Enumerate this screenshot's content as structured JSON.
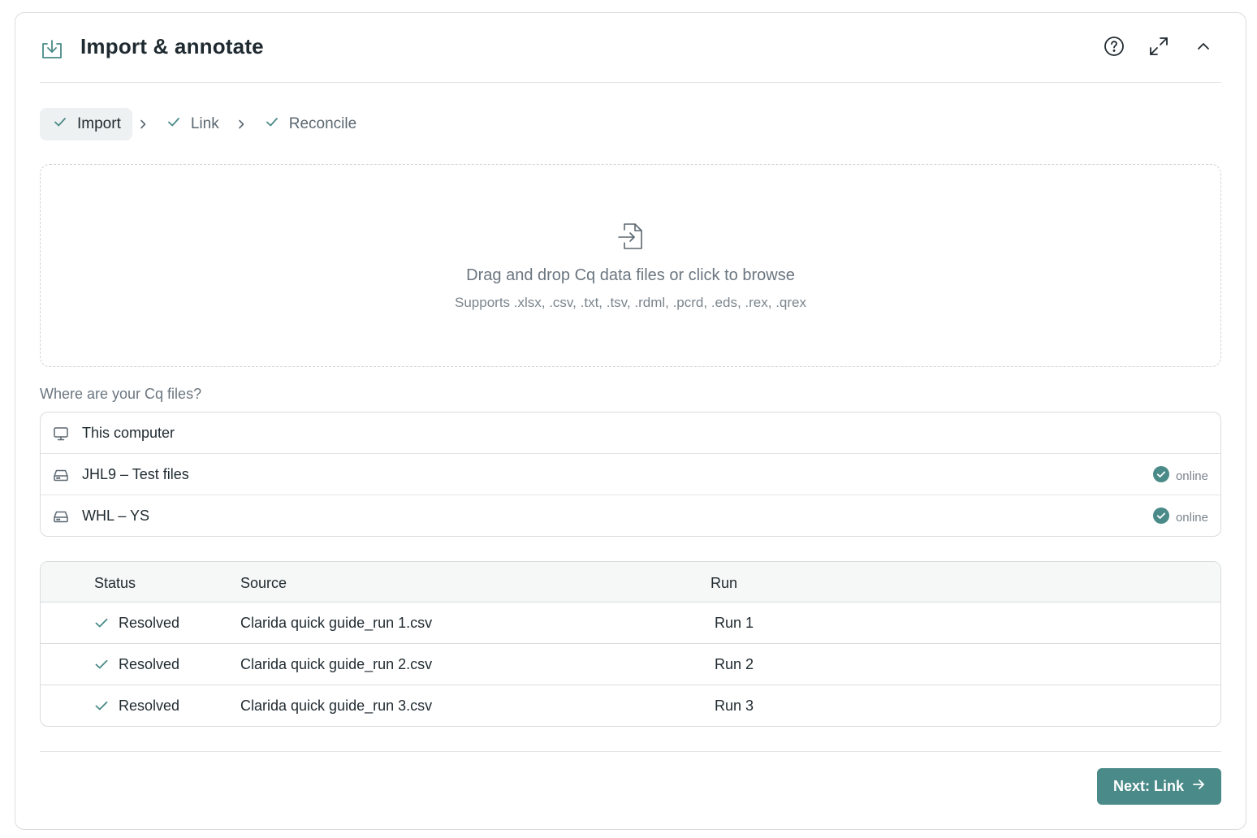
{
  "header": {
    "title": "Import & annotate",
    "icons": [
      "import-tray-icon",
      "help-circle-icon",
      "expand-icon",
      "chevron-up-icon"
    ]
  },
  "steps": [
    {
      "label": "Import",
      "active": true,
      "done": true
    },
    {
      "label": "Link",
      "active": false,
      "done": true
    },
    {
      "label": "Reconcile",
      "active": false,
      "done": true
    }
  ],
  "dropzone": {
    "main_text": "Drag and drop Cq data files or click to browse",
    "sub_text": "Supports .xlsx, .csv, .txt, .tsv, .rdml, .pcrd, .eds, .rex, .qrex"
  },
  "locations": {
    "label": "Where are your Cq files?",
    "items": [
      {
        "name": "This computer",
        "icon": "monitor-icon",
        "status": ""
      },
      {
        "name": "JHL9 – Test files",
        "icon": "drive-icon",
        "status": "online"
      },
      {
        "name": "WHL – YS",
        "icon": "drive-icon",
        "status": "online"
      }
    ]
  },
  "table": {
    "headers": {
      "status": "Status",
      "source": "Source",
      "run": "Run"
    },
    "rows": [
      {
        "status": "Resolved",
        "source": "Clarida quick guide_run 1.csv",
        "run": "Run 1"
      },
      {
        "status": "Resolved",
        "source": "Clarida quick guide_run 2.csv",
        "run": "Run 2"
      },
      {
        "status": "Resolved",
        "source": "Clarida quick guide_run 3.csv",
        "run": "Run 3"
      }
    ]
  },
  "footer": {
    "next_label": "Next: Link"
  },
  "colors": {
    "accent": "#4a8a88",
    "text": "#1f2a30",
    "muted": "#6b7680",
    "border": "#d9dcdf"
  }
}
